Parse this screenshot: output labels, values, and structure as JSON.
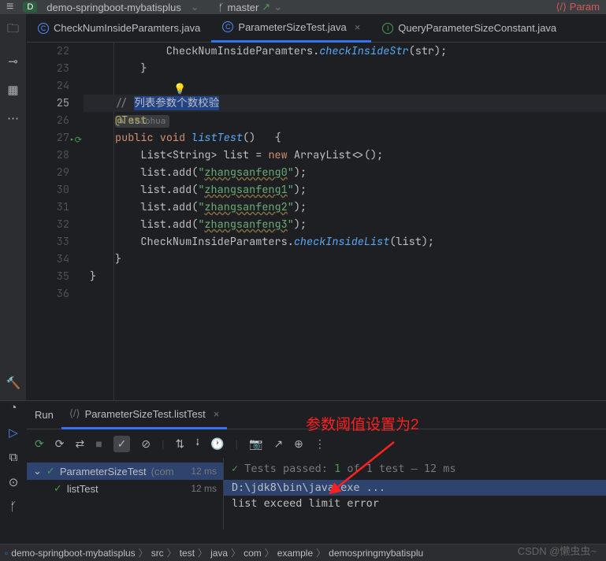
{
  "titlebar": {
    "project_initial": "D",
    "project_name": "demo-springboot-mybatisplus",
    "branch": "master",
    "param_link": "Param"
  },
  "tabs": [
    {
      "icon": "C",
      "label": "CheckNumInsideParamters.java",
      "active": false,
      "closable": false
    },
    {
      "icon": "C",
      "label": "ParameterSizeTest.java",
      "active": true,
      "closable": true
    },
    {
      "icon": "I",
      "label": "QueryParameterSizeConstant.java",
      "active": false,
      "closable": false
    }
  ],
  "lines": [
    "22",
    "23",
    "24",
    "25",
    "26",
    "27",
    "28",
    "29",
    "30",
    "31",
    "32",
    "33",
    "34",
    "35",
    "36"
  ],
  "active_line_idx": 3,
  "code": {
    "l22_a": "        CheckNumInsideParamters.",
    "l22_b": "checkInsideStr",
    "l22_c": "(",
    "l22_d": "str",
    "l22_e": ");",
    "l23": "    }",
    "l25_a": "// ",
    "l25_b": "列表参数个数校验",
    "author_hint": "shaohua",
    "l26": "@Test",
    "l27_a": "public",
    "l27_b": " ",
    "l27_c": "void",
    "l27_d": " ",
    "l27_e": "listTest",
    "l27_f": "()   {",
    "l28_a": "    List",
    "l28_b": "<",
    "l28_c": "String",
    "l28_d": "> list = ",
    "l28_e": "new",
    "l28_f": " ArrayList",
    "l28_g": "<>",
    "l28_h": "();",
    "l29_a": "    list.add(",
    "l29_b": "\"",
    "l29_c": "zhangsanfeng0",
    "l29_d": "\"",
    "l29_e": ");",
    "l30_c": "zhangsanfeng1",
    "l31_c": "zhangsanfeng2",
    "l32_c": "zhangsanfeng3",
    "l33_a": "    CheckNumInsideParamters.",
    "l33_b": "checkInsideList",
    "l33_c": "(",
    "l33_d": "list",
    "l33_e": ");",
    "l34": "}",
    "l35": "}"
  },
  "run": {
    "label": "Run",
    "tab": "ParameterSizeTest.listTest",
    "tests_passed_a": "Tests passed:",
    "tests_passed_b": "1",
    "tests_passed_c": "of 1 test",
    "tests_time": "– 12 ms",
    "tree_root": "ParameterSizeTest",
    "tree_root_suffix": "(com",
    "tree_root_time": "12 ms",
    "tree_child": "listTest",
    "tree_child_time": "12 ms",
    "out1": "D:\\jdk8\\bin\\java.exe ...",
    "out2": "list exceed limit error"
  },
  "annotation": "参数阈值设置为2",
  "crumbs": [
    "demo-springboot-mybatisplus",
    "src",
    "test",
    "java",
    "com",
    "example",
    "demospringmybatisplu"
  ],
  "watermark": "CSDN @懒虫虫~"
}
